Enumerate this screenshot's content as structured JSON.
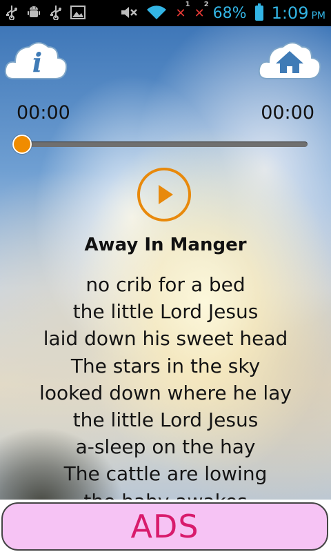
{
  "status_bar": {
    "battery": "68%",
    "time": "1:09",
    "ampm": "PM",
    "icons": [
      "usb-icon",
      "android-debug-icon",
      "usb-icon",
      "image-icon",
      "mute-icon",
      "wifi-icon",
      "no-signal-1-icon",
      "no-signal-2-icon",
      "battery-charging-icon"
    ],
    "sim_1": "1",
    "sim_2": "2",
    "accent": "#33b5e5"
  },
  "player": {
    "current_time": "00:00",
    "total_time": "00:00",
    "progress": 0,
    "accent": "#f08c00"
  },
  "buttons": {
    "info_icon": "info-cloud-icon",
    "home_icon": "home-cloud-icon",
    "play_icon": "play-icon"
  },
  "song": {
    "title": "Away In Manger",
    "lyrics": [
      "no crib for a bed",
      "the little Lord Jesus",
      "laid down his sweet head",
      "The stars in the sky",
      "looked down where he lay",
      "the little Lord Jesus",
      "a-sleep on the hay",
      "The cattle are lowing",
      "the baby awakes"
    ]
  },
  "ads": {
    "label": "ADS",
    "bg_color": "#f6c3f4",
    "text_color": "#d81b6c"
  }
}
